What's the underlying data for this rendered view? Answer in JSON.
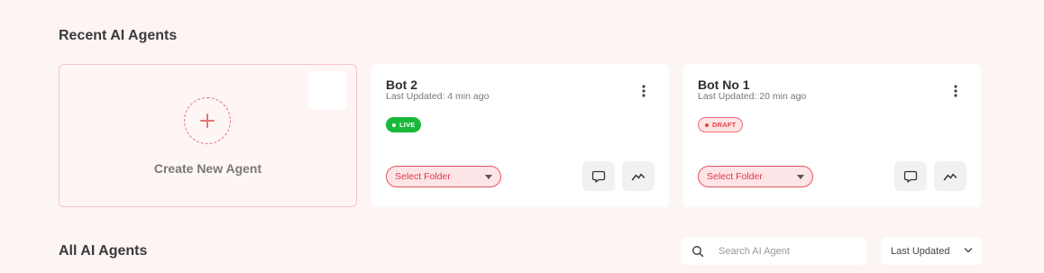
{
  "recent_section": {
    "title": "Recent AI Agents"
  },
  "create_card": {
    "label": "Create New Agent",
    "icon": "plus-icon"
  },
  "bots": [
    {
      "name": "Bot 2",
      "updated": "Last Updated: 4 min ago",
      "status": "LIVE",
      "folder_placeholder": "Select Folder"
    },
    {
      "name": "Bot No 1",
      "updated": "Last Updated: 20 min ago",
      "status": "DRAFT",
      "folder_placeholder": "Select Folder"
    }
  ],
  "all_section": {
    "title": "All AI Agents"
  },
  "search": {
    "placeholder": "Search AI Agent",
    "value": ""
  },
  "sort": {
    "selected": "Last Updated"
  },
  "colors": {
    "accent": "#e5555e",
    "live": "#18b83c",
    "draft_bg": "#fde4e4",
    "page_bg": "#fcf5f4"
  }
}
